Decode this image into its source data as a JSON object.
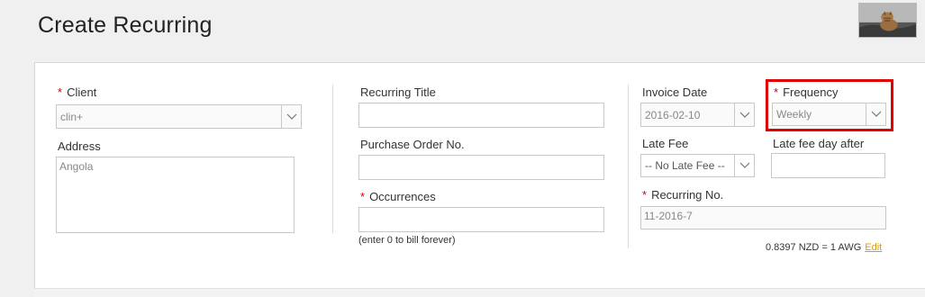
{
  "header": {
    "title": "Create Recurring",
    "avatar": "user-avatar-photo"
  },
  "form": {
    "client": {
      "label": "Client",
      "required": "*",
      "value": "clin+"
    },
    "address": {
      "label": "Address",
      "value": "Angola"
    },
    "recurring_title": {
      "label": "Recurring Title",
      "value": ""
    },
    "purchase_order": {
      "label": "Purchase Order No.",
      "value": ""
    },
    "occurrences": {
      "label": "Occurrences",
      "required": "*",
      "value": "",
      "hint": "(enter 0 to bill forever)"
    },
    "invoice_date": {
      "label": "Invoice Date",
      "value": "2016-02-10"
    },
    "frequency": {
      "label": "Frequency",
      "required": "*",
      "value": "Weekly"
    },
    "late_fee": {
      "label": "Late Fee",
      "value": "-- No Late Fee --"
    },
    "late_fee_day_after": {
      "label": "Late fee day after",
      "value": ""
    },
    "recurring_no": {
      "label": "Recurring No.",
      "required": "*",
      "value": "11-2016-7"
    },
    "exchange_rate": {
      "text": "0.8397 NZD = 1 AWG",
      "edit_label": "Edit"
    }
  },
  "colors": {
    "required": "#d0021b",
    "highlight": "#e00000",
    "link": "#d49a1a"
  },
  "icons": {
    "dropdown": "chevron-down-icon"
  }
}
